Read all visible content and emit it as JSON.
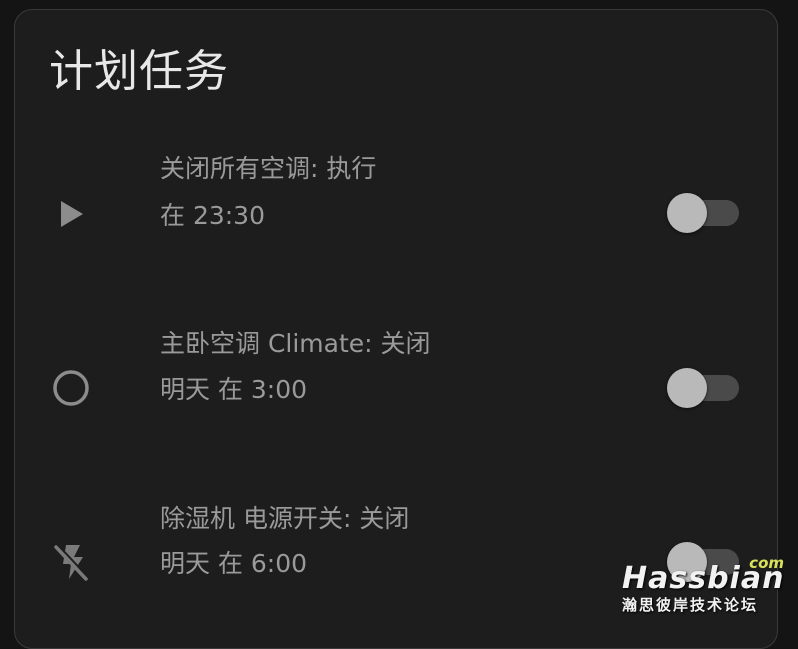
{
  "card": {
    "title": "计划任务"
  },
  "rows": [
    {
      "icon": "play-icon",
      "name": "关闭所有空调: 执行",
      "secondary": "在 23:30",
      "enabled": false
    },
    {
      "icon": "circle-outline-icon",
      "name": "主卧空调 Climate: 关闭",
      "secondary": "明天 在 3:00",
      "enabled": false
    },
    {
      "icon": "flash-off-icon",
      "name": "除湿机 电源开关: 关闭",
      "secondary": "明天 在 6:00",
      "enabled": false
    }
  ],
  "watermark": {
    "com": "com",
    "brand": "Hassbian",
    "tagline": "瀚思彼岸技术论坛"
  },
  "colors": {
    "background": "#141414",
    "card": "#1d1d1d",
    "title_text": "#e8e8e8",
    "secondary_text": "#9a9a9a",
    "toggle_off_track": "#4a4a4a",
    "toggle_off_knob": "#b9b9b9",
    "watermark_accent": "#d9e05a"
  }
}
